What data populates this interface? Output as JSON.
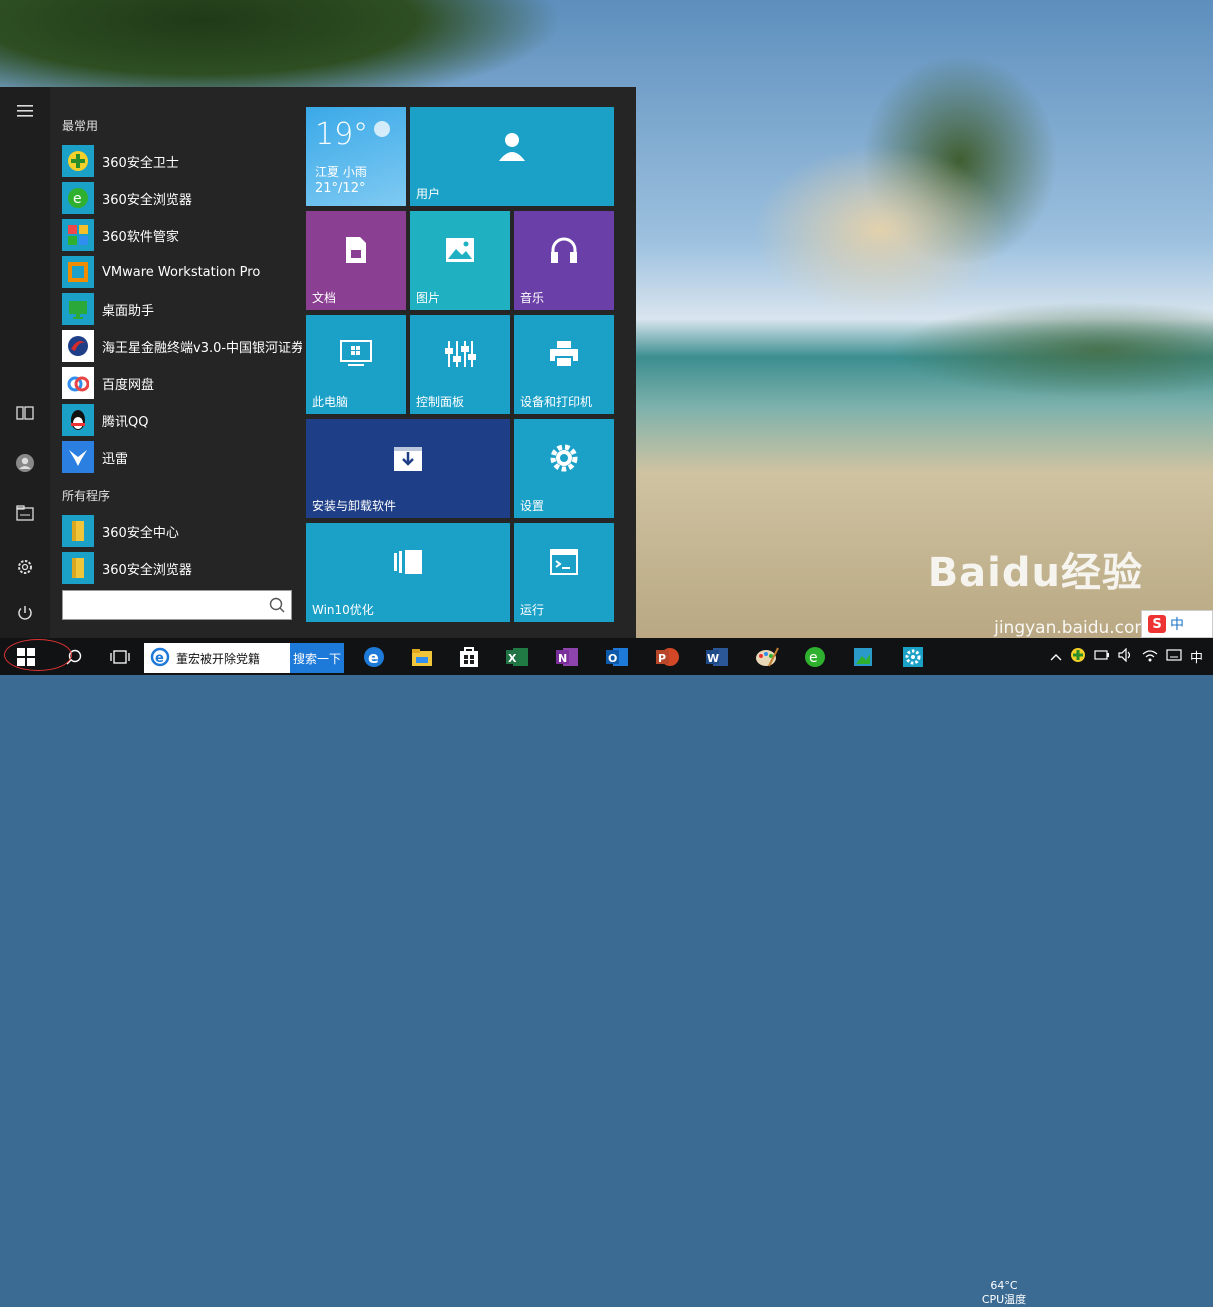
{
  "desktop": {
    "watermark": "Baidu经验",
    "watermark_url": "jingyan.baidu.com",
    "ime_indicator": "中"
  },
  "start_menu": {
    "rail": {
      "menu_icon": "hamburger-icon",
      "items": [
        "tablet-mode-icon",
        "user-icon",
        "file-explorer-icon",
        "settings-icon",
        "power-icon"
      ]
    },
    "most_used_title": "最常用",
    "most_used": [
      {
        "label": "360安全卫士",
        "icon": "360-safe-guard-icon",
        "color": "#2a8f2a"
      },
      {
        "label": "360安全浏览器",
        "icon": "360-browser-icon",
        "color": "#2fb12f"
      },
      {
        "label": "360软件管家",
        "icon": "360-software-manager-icon",
        "color": "#1e8ed6"
      },
      {
        "label": "VMware Workstation Pro",
        "icon": "vmware-icon",
        "color": "#f08c00"
      },
      {
        "label": "桌面助手",
        "icon": "desktop-helper-icon",
        "color": "#2aa83a"
      },
      {
        "label": "海王星金融终端v3.0-中国银河证券",
        "icon": "neptune-finance-icon",
        "color": "#d62b2b"
      },
      {
        "label": "百度网盘",
        "icon": "baidu-netdisk-icon",
        "color": "#2f8ef0"
      },
      {
        "label": "腾讯QQ",
        "icon": "qq-penguin-icon",
        "color": "#ffffff"
      },
      {
        "label": "迅雷",
        "icon": "xunlei-bird-icon",
        "color": "#2a7fe0"
      }
    ],
    "all_programs_title": "所有程序",
    "all_programs": [
      {
        "label": "360安全中心",
        "icon": "folder-icon",
        "color": "#f0c53a"
      },
      {
        "label": "360安全浏览器",
        "icon": "folder-icon",
        "color": "#f0c53a"
      }
    ],
    "search": {
      "placeholder": "",
      "value": ""
    },
    "tiles": {
      "weather": {
        "temp": "19°",
        "location": "江夏  小雨",
        "range": "21°/12°"
      },
      "user": {
        "label": "用户",
        "icon": "person-icon"
      },
      "docs": {
        "label": "文档",
        "icon": "document-icon"
      },
      "pictures": {
        "label": "图片",
        "icon": "picture-icon"
      },
      "music": {
        "label": "音乐",
        "icon": "headphones-icon"
      },
      "this_pc": {
        "label": "此电脑",
        "icon": "monitor-icon"
      },
      "control_panel": {
        "label": "控制面板",
        "icon": "sliders-icon"
      },
      "devices_printers": {
        "label": "设备和打印机",
        "icon": "printer-icon"
      },
      "install_uninstall": {
        "label": "安装与卸载软件",
        "icon": "download-box-icon"
      },
      "settings": {
        "label": "设置",
        "icon": "gear-icon"
      },
      "win10_optimize": {
        "label": "Win10优化",
        "icon": "tiles-optimize-icon"
      },
      "run": {
        "label": "运行",
        "icon": "run-window-icon"
      }
    },
    "colors": {
      "accent": "#1ba0c8",
      "purple_doc": "#8b3f92",
      "music": "#6b3fa8",
      "navy": "#1e3f87"
    }
  },
  "taskbar": {
    "ie_label": "董宏被开除党籍",
    "search_button": "搜索一下",
    "pinned": [
      "edge-icon",
      "file-explorer-icon",
      "store-icon",
      "excel-icon",
      "onenote-icon",
      "outlook-icon",
      "powerpoint-icon",
      "word-icon",
      "paint-icon",
      "360-browser-icon",
      "photos-icon",
      "settings-icon"
    ],
    "cpu_temp": "64°C",
    "cpu_label": "CPU温度",
    "tray_lang": "中"
  }
}
